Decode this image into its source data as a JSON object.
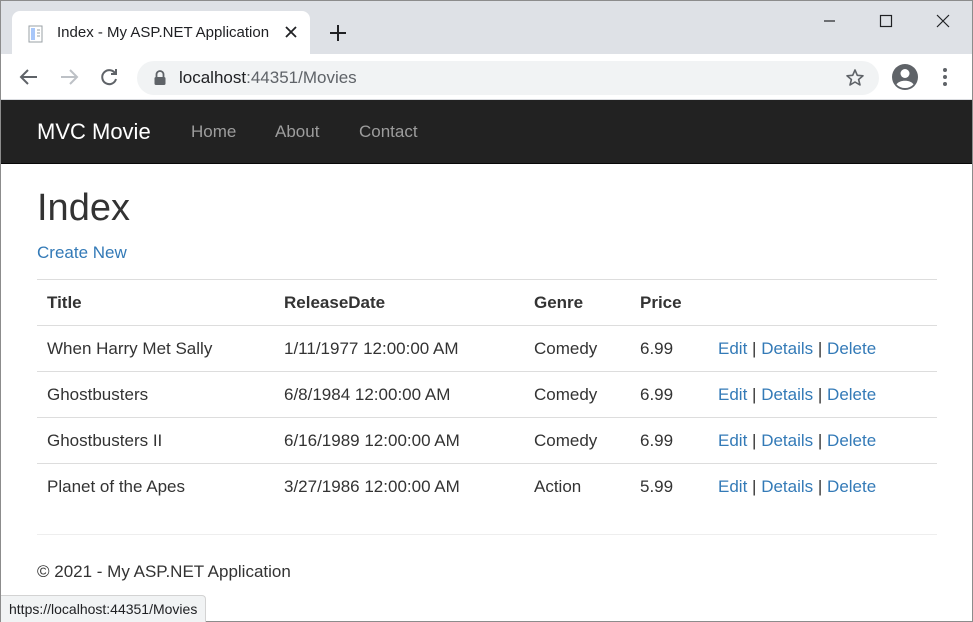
{
  "browser": {
    "tab_title": "Index - My ASP.NET Application",
    "url_host": "localhost",
    "url_rest": ":44351/Movies",
    "status_url": "https://localhost:44351/Movies"
  },
  "navbar": {
    "brand": "MVC Movie",
    "links": [
      "Home",
      "About",
      "Contact"
    ]
  },
  "page": {
    "title": "Index",
    "create_new": "Create New"
  },
  "table": {
    "headers": [
      "Title",
      "ReleaseDate",
      "Genre",
      "Price"
    ],
    "actions": {
      "edit": "Edit",
      "details": "Details",
      "delete": "Delete",
      "separator": "|"
    },
    "rows": [
      {
        "title": "When Harry Met Sally",
        "release_date": "1/11/1977 12:00:00 AM",
        "genre": "Comedy",
        "price": "6.99"
      },
      {
        "title": "Ghostbusters",
        "release_date": "6/8/1984 12:00:00 AM",
        "genre": "Comedy",
        "price": "6.99"
      },
      {
        "title": "Ghostbusters II",
        "release_date": "6/16/1989 12:00:00 AM",
        "genre": "Comedy",
        "price": "6.99"
      },
      {
        "title": "Planet of the Apes",
        "release_date": "3/27/1986 12:00:00 AM",
        "genre": "Action",
        "price": "5.99"
      }
    ]
  },
  "footer": {
    "text": "© 2021 - My ASP.NET Application"
  },
  "colors": {
    "link": "#337ab7",
    "navbar_bg": "#222222",
    "nav_link": "#9d9d9d"
  },
  "icons": [
    "document-icon",
    "close-icon",
    "plus-icon",
    "minimize-icon",
    "maximize-icon",
    "window-close-icon",
    "back-arrow-icon",
    "forward-arrow-icon",
    "reload-icon",
    "lock-icon",
    "star-icon",
    "profile-icon",
    "kebab-menu-icon"
  ]
}
